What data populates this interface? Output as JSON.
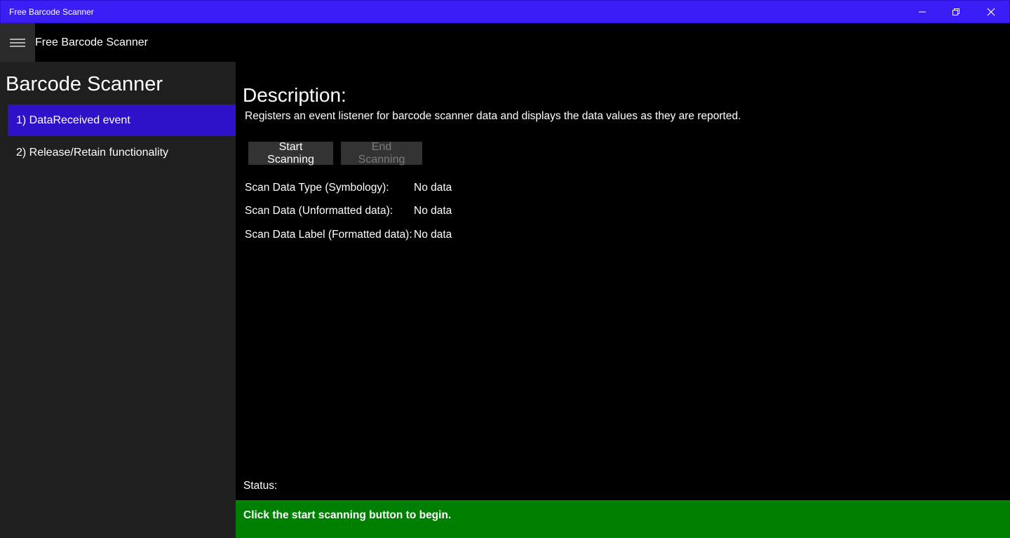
{
  "window": {
    "title": "Free Barcode Scanner",
    "controls": {
      "minimize_icon": "minimize-icon",
      "maximize_icon": "restore-icon",
      "close_icon": "close-icon"
    }
  },
  "appbar": {
    "menu_icon": "hamburger-icon",
    "title": "Free Barcode Scanner"
  },
  "sidebar": {
    "heading": "Barcode Scanner",
    "items": [
      {
        "label": "1) DataReceived event",
        "selected": true
      },
      {
        "label": "2) Release/Retain functionality",
        "selected": false
      }
    ]
  },
  "main": {
    "description_heading": "Description:",
    "description_text": "Registers an event listener for barcode scanner data and displays the data values as they are reported.",
    "buttons": {
      "start_label": "Start Scanning",
      "end_label": "End Scanning"
    },
    "fields": [
      {
        "label": "Scan Data Type (Symbology):",
        "value": "No data"
      },
      {
        "label": "Scan Data (Unformatted data):",
        "value": "No data"
      },
      {
        "label": "Scan Data Label (Formatted data):",
        "value": "No data"
      }
    ],
    "status_label": "Status:",
    "status_message": "Click the start scanning button to begin."
  },
  "colors": {
    "titlebar": "#3b1ef5",
    "nav_selected": "#2d12c9",
    "status_bar": "#008000",
    "sidebar_bg": "#1f1f1f"
  }
}
